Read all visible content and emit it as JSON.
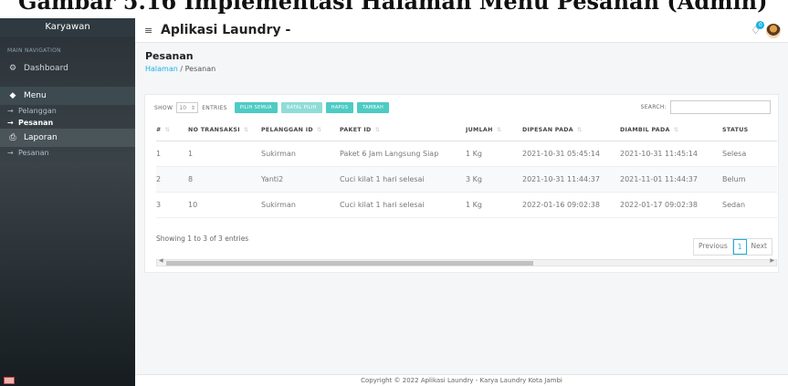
{
  "caption": "Gambar 5.16 Implementasi Halaman Menu Pesanan (Admin)",
  "sidebar": {
    "brand": "Karyawan",
    "section_heading": "MAIN NAVIGATION",
    "items": [
      {
        "label": "Dashboard",
        "icon": "dashboard-icon"
      },
      {
        "label": "Menu",
        "icon": "diamond-icon"
      },
      {
        "label": "Laporan",
        "icon": "printer-icon"
      }
    ],
    "menu_sub": [
      "Pelanggan",
      "Pesanan"
    ],
    "laporan_sub": [
      "Pesanan"
    ],
    "arrow": "→"
  },
  "topbar": {
    "title": "Aplikasi Laundry -",
    "notif_count": "0"
  },
  "page": {
    "title": "Pesanan",
    "breadcrumb_home": "Halaman",
    "breadcrumb_sep": "/",
    "breadcrumb_current": "Pesanan"
  },
  "controls": {
    "show_label": "SHOW",
    "entries_value": "10",
    "entries_label": "ENTRIES",
    "btn_select_all": "PILIH SEMUA",
    "btn_cancel_select": "BATAL PILIH",
    "btn_delete": "HAPUS",
    "btn_add": "TAMBAH",
    "search_label": "SEARCH:"
  },
  "table": {
    "headers": [
      "#",
      "NO TRANSAKSI",
      "PELANGGAN ID",
      "PAKET ID",
      "JUMLAH",
      "DIPESAN PADA",
      "DIAMBIL PADA",
      "STATUS"
    ],
    "rows": [
      [
        "1",
        "1",
        "Sukirman",
        "Paket 6 Jam Langsung Siap",
        "1 Kg",
        "2021-10-31 05:45:14",
        "2021-10-31 11:45:14",
        "Selesa"
      ],
      [
        "2",
        "8",
        "Yanti2",
        "Cuci kilat 1 hari selesai",
        "3 Kg",
        "2021-10-31 11:44:37",
        "2021-11-01 11:44:37",
        "Belum"
      ],
      [
        "3",
        "10",
        "Sukirman",
        "Cuci kilat 1 hari selesai",
        "1 Kg",
        "2022-01-16 09:02:38",
        "2022-01-17 09:02:38",
        "Sedan"
      ]
    ]
  },
  "info_text": "Showing 1 to 3 of 3 entries",
  "pagination": {
    "previous": "Previous",
    "page": "1",
    "next": "Next"
  },
  "footer": "Copyright © 2022 Aplikasi Laundry - Karya Laundry Kota Jambi",
  "colors": {
    "accent": "#19b2e2",
    "button": "#4ecbc4",
    "sidebar": "#2a3238"
  }
}
